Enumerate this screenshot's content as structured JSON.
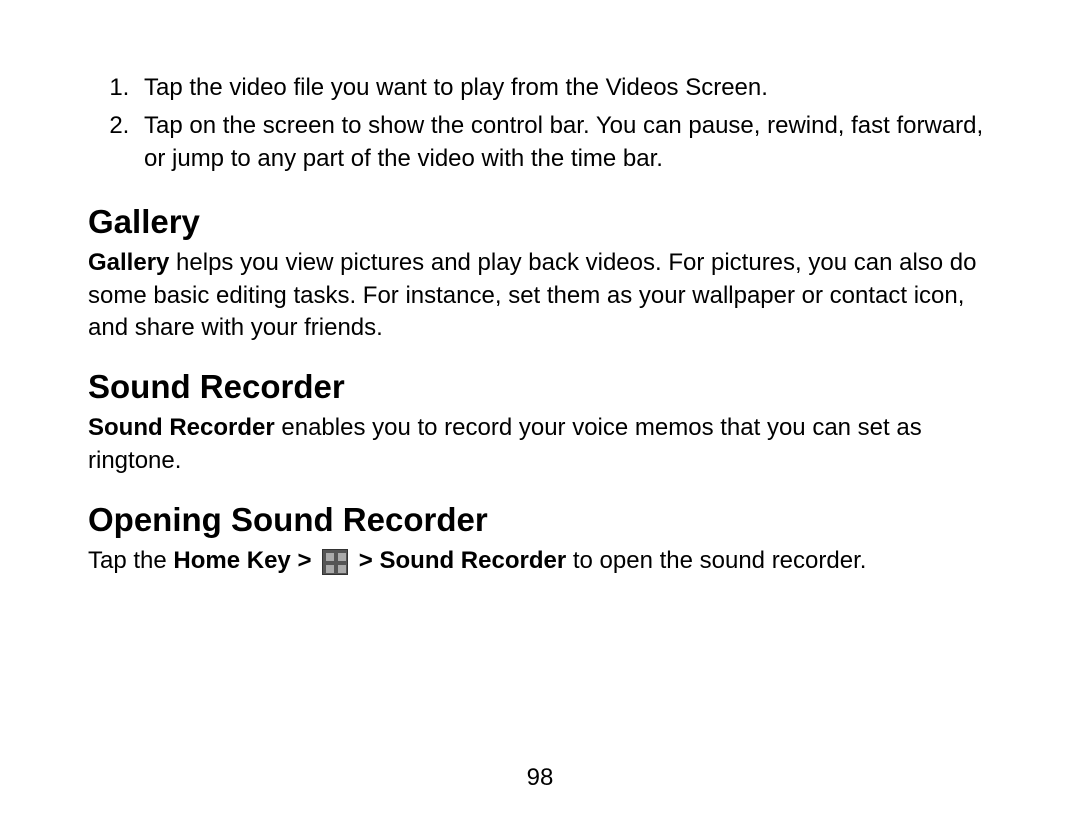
{
  "list": {
    "items": [
      "Tap the video file you want to play from the Videos Screen.",
      "Tap on the screen to show the control bar. You can pause, rewind, fast forward, or jump to any part of the video with the time bar."
    ]
  },
  "gallery": {
    "heading": "Gallery",
    "bold_lead": "Gallery",
    "body": " helps you view pictures and play back videos. For pictures, you can also do some basic editing tasks. For instance, set them as your wallpaper or contact icon, and share with your friends."
  },
  "sound_recorder": {
    "heading": "Sound Recorder",
    "bold_lead": "Sound Recorder",
    "body": " enables you to record your voice memos that you can set as ringtone."
  },
  "opening": {
    "heading": "Opening Sound Recorder",
    "pre_text": "Tap the ",
    "home_key": "Home Key > ",
    "post_icon": " > Sound Recorder",
    "tail": " to open the sound recorder."
  },
  "page_number": "98"
}
